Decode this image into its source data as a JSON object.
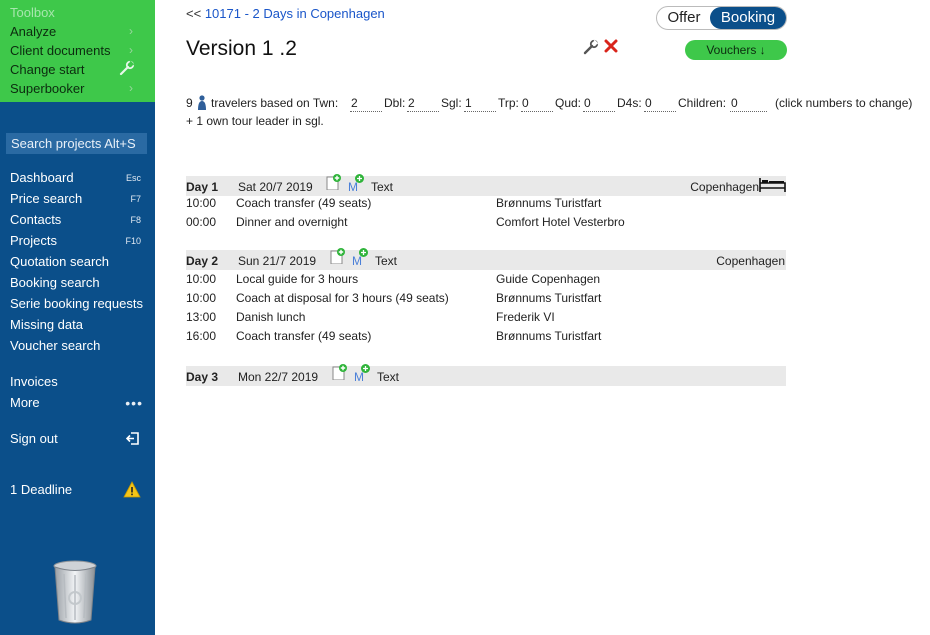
{
  "sidebar": {
    "toolbox": {
      "title": "Toolbox",
      "items": [
        {
          "label": "Analyze",
          "icon": "chevron-right-icon"
        },
        {
          "label": "Client documents",
          "icon": "chevron-right-icon"
        },
        {
          "label": "Change start",
          "icon": "wrench-icon"
        },
        {
          "label": "Superbooker",
          "icon": "chevron-right-icon"
        }
      ]
    },
    "search_placeholder": "Search projects Alt+S",
    "nav": [
      {
        "label": "Dashboard",
        "key": "Esc"
      },
      {
        "label": "Price search",
        "key": "F7"
      },
      {
        "label": "Contacts",
        "key": "F8"
      },
      {
        "label": "Projects",
        "key": "F10"
      },
      {
        "label": "Quotation search",
        "key": ""
      },
      {
        "label": "Booking search",
        "key": ""
      },
      {
        "label": "Serie booking requests",
        "key": ""
      },
      {
        "label": "Missing data",
        "key": ""
      },
      {
        "label": "Voucher search",
        "key": ""
      }
    ],
    "invoices": "Invoices",
    "more": "More",
    "more_icon": "•••",
    "sign_out": "Sign out",
    "deadline": "1 Deadline"
  },
  "header": {
    "back": "<<",
    "project_link": "10171 - 2 Days in Copenhagen",
    "version_title": "Version 1 .2",
    "toggle_offer": "Offer",
    "toggle_booking": "Booking",
    "vouchers": "Vouchers ↓"
  },
  "travelers": {
    "count": "9",
    "based_on": "travelers based on Twn:",
    "twn": "2",
    "dbl_label": "Dbl:",
    "dbl": "2",
    "sgl_label": "Sgl:",
    "sgl": "1",
    "trp_label": "Trp:",
    "trp": "0",
    "qud_label": "Qud:",
    "qud": "0",
    "d4s_label": "D4s:",
    "d4s": "0",
    "children_label": "Children:",
    "children": "0",
    "hint": "(click numbers to change)",
    "tour_leader": "+ 1 own tour leader in sgl."
  },
  "days": [
    {
      "label": "Day 1",
      "date": "Sat 20/7 2019",
      "m": "M",
      "text": "Text",
      "location": "Copenhagen",
      "rows": [
        {
          "time": "10:00",
          "desc": "Coach transfer (49 seats)",
          "supplier": "Brønnums Turistfart"
        },
        {
          "time": "00:00",
          "desc": "Dinner and overnight",
          "supplier": "Comfort Hotel Vesterbro"
        }
      ]
    },
    {
      "label": "Day 2",
      "date": "Sun 21/7 2019",
      "m": "M",
      "text": "Text",
      "location": "Copenhagen",
      "rows": [
        {
          "time": "10:00",
          "desc": "Local guide for 3 hours",
          "supplier": "Guide Copenhagen"
        },
        {
          "time": "10:00",
          "desc": "Coach at disposal for 3 hours (49 seats)",
          "supplier": "Brønnums Turistfart"
        },
        {
          "time": "13:00",
          "desc": "Danish lunch",
          "supplier": "Frederik VI"
        },
        {
          "time": "16:00",
          "desc": "Coach transfer (49 seats)",
          "supplier": "Brønnums Turistfart"
        }
      ]
    },
    {
      "label": "Day 3",
      "date": "Mon 22/7 2019",
      "m": "M",
      "text": "Text",
      "location": "",
      "rows": []
    }
  ]
}
